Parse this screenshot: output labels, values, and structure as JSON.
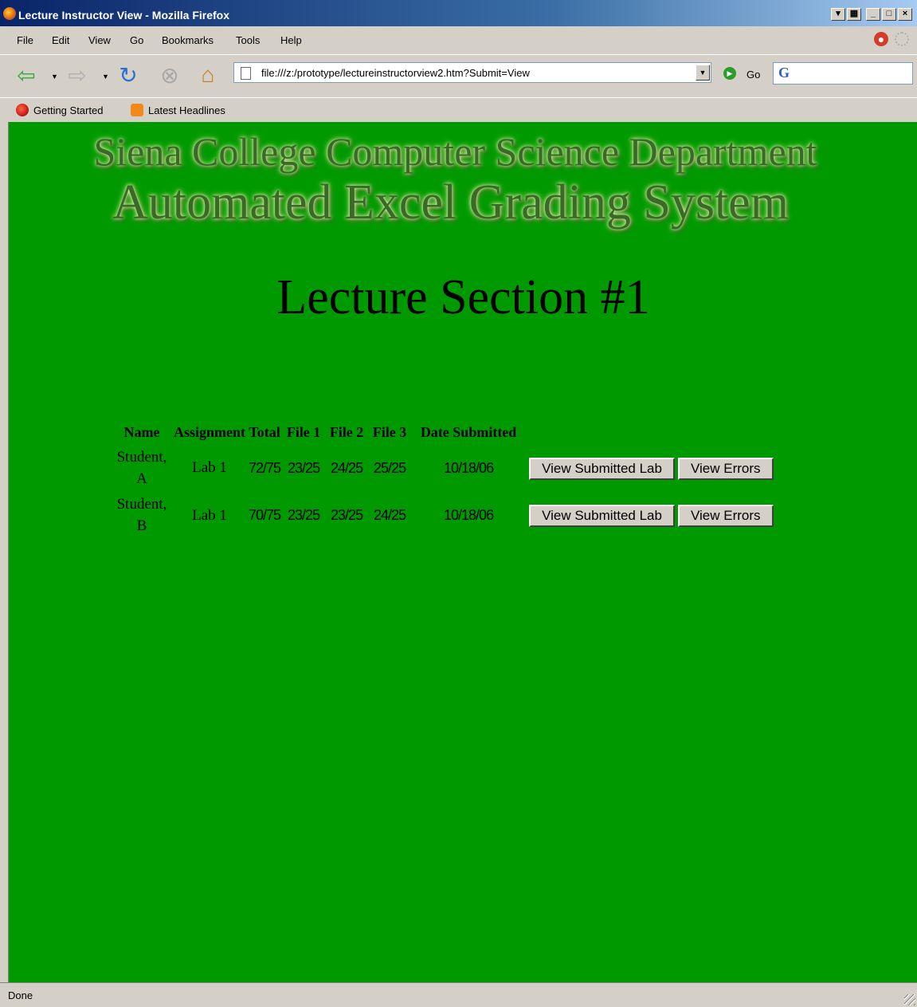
{
  "window": {
    "title": "Lecture Instructor View - Mozilla Firefox"
  },
  "menu": [
    "File",
    "Edit",
    "View",
    "Go",
    "Bookmarks",
    "Tools",
    "Help"
  ],
  "nav": {
    "url": "file:///z:/prototype/lectureinstructorview2.htm?Submit=View",
    "go_label": "Go",
    "search_value": ""
  },
  "bookmarks": [
    "Getting Started",
    "Latest Headlines"
  ],
  "banner": {
    "line1": "Siena College Computer Science Department",
    "line2": "Automated Excel Grading System"
  },
  "page": {
    "title": "Lecture Section #1"
  },
  "table": {
    "headers": {
      "name": "Name",
      "assignment": "Assignment",
      "total": "Total",
      "file1": "File 1",
      "file2": "File 2",
      "file3": "File 3",
      "date": "Date Submitted"
    },
    "rows": [
      {
        "name": "Student, A",
        "assignment": "Lab 1",
        "total": "72/75",
        "file1": "23/25",
        "file2": "24/25",
        "file3": "25/25",
        "date": "10/18/06",
        "view_lab": "View Submitted Lab",
        "view_errors": "View Errors"
      },
      {
        "name": "Student, B",
        "assignment": "Lab 1",
        "total": "70/75",
        "file1": "23/25",
        "file2": "23/25",
        "file3": "24/25",
        "date": "10/18/06",
        "view_lab": "View Submitted Lab",
        "view_errors": "View Errors"
      }
    ]
  },
  "status": {
    "text": "Done"
  },
  "colors": {
    "page_background": "#009900",
    "titlebar": "#0a246a",
    "chrome": "#d4d0c8"
  }
}
